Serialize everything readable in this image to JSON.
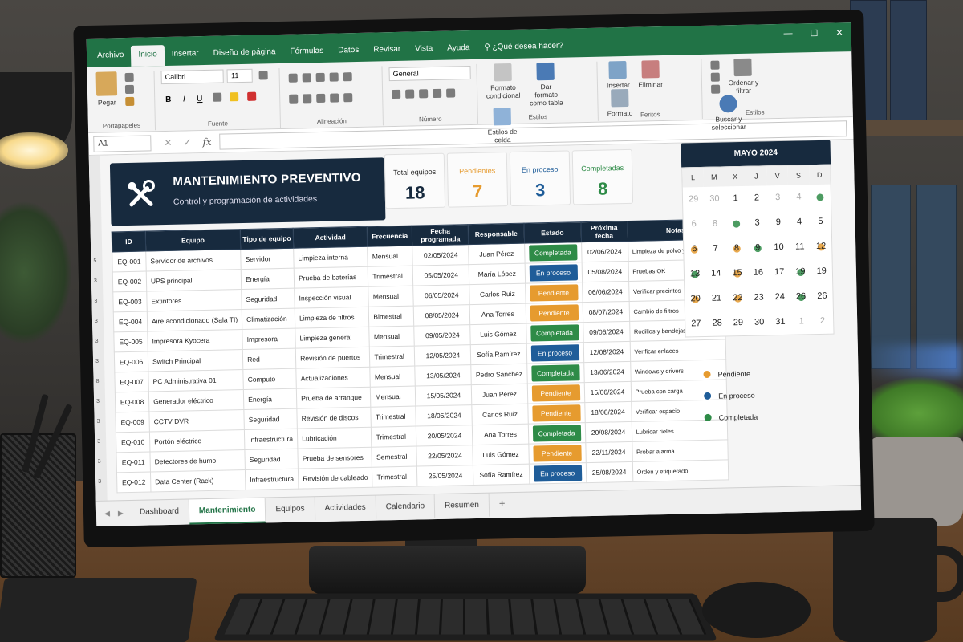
{
  "ribbon": {
    "tabs": [
      "Archivo",
      "Inicio",
      "Insertar",
      "Diseño de página",
      "Fórmulas",
      "Datos",
      "Revisar",
      "Vista",
      "Ayuda"
    ],
    "active_tab": "Inicio",
    "tell_me": "¿Qué desea hacer?",
    "paste_label": "Pegar",
    "clipboard_group": "Portapapeles",
    "font_name": "Calibri",
    "font_size": "11",
    "font_group": "Fuente",
    "alignment_group": "Alineación",
    "number_format": "General",
    "number_group": "Número",
    "cond_format_label": "Formato condicional",
    "format_table_label": "Dar formato como tabla",
    "cell_styles_label": "Estilos de celda",
    "styles_group": "Estilos",
    "insert_label": "Insertar",
    "delete_label": "Eliminar",
    "format_label": "Formato",
    "cells_group": "Feritos",
    "sort_label": "Ordenar y filtrar",
    "find_label": "Buscar y seleccionar",
    "editing_group": "Estilos"
  },
  "formula_bar": {
    "name_box": "A1",
    "fx": "fx"
  },
  "dashboard": {
    "title": "MANTENIMIENTO PREVENTIVO",
    "subtitle": "Control y programación de actividades",
    "kpis": [
      {
        "label": "Total equipos",
        "value": "18",
        "color": "#172a3e"
      },
      {
        "label": "Pendientes",
        "value": "7",
        "color": "#e69b2f"
      },
      {
        "label": "En proceso",
        "value": "3",
        "color": "#1f5d99"
      },
      {
        "label": "Completadas",
        "value": "8",
        "color": "#2e8b47"
      }
    ]
  },
  "table": {
    "headers": [
      "ID",
      "Equipo",
      "Tipo de equipo",
      "Actividad",
      "Frecuencia",
      "Fecha programada",
      "Responsable",
      "Estado",
      "Próxima fecha",
      "Notas"
    ],
    "rows": [
      [
        "EQ-001",
        "Servidor de archivos",
        "Servidor",
        "Limpieza interna",
        "Mensual",
        "02/05/2024",
        "Juan Pérez",
        "Completada",
        "02/06/2024",
        "Limpieza de polvo y ventiladores"
      ],
      [
        "EQ-002",
        "UPS principal",
        "Energía",
        "Prueba de baterías",
        "Trimestral",
        "05/05/2024",
        "María López",
        "En proceso",
        "05/08/2024",
        "Pruebas OK"
      ],
      [
        "EQ-003",
        "Extintores",
        "Seguridad",
        "Inspección visual",
        "Mensual",
        "06/05/2024",
        "Carlos Ruiz",
        "Pendiente",
        "06/06/2024",
        "Verificar precintos"
      ],
      [
        "EQ-004",
        "Aire acondicionado (Sala TI)",
        "Climatización",
        "Limpieza de filtros",
        "Bimestral",
        "08/05/2024",
        "Ana Torres",
        "Pendiente",
        "08/07/2024",
        "Cambio de filtros"
      ],
      [
        "EQ-005",
        "Impresora Kyocera",
        "Impresora",
        "Limpieza general",
        "Mensual",
        "09/05/2024",
        "Luis Gómez",
        "Completada",
        "09/06/2024",
        "Rodillos y bandejas"
      ],
      [
        "EQ-006",
        "Switch Principal",
        "Red",
        "Revisión de puertos",
        "Trimestral",
        "12/05/2024",
        "Sofía Ramírez",
        "En proceso",
        "12/08/2024",
        "Verificar enlaces"
      ],
      [
        "EQ-007",
        "PC Administrativa 01",
        "Computo",
        "Actualizaciones",
        "Mensual",
        "13/05/2024",
        "Pedro Sánchez",
        "Completada",
        "13/06/2024",
        "Windows y drivers"
      ],
      [
        "EQ-008",
        "Generador eléctrico",
        "Energía",
        "Prueba de arranque",
        "Mensual",
        "15/05/2024",
        "Juan Pérez",
        "Pendiente",
        "15/06/2024",
        "Prueba con carga"
      ],
      [
        "EQ-009",
        "CCTV DVR",
        "Seguridad",
        "Revisión de discos",
        "Trimestral",
        "18/05/2024",
        "Carlos Ruiz",
        "Pendiente",
        "18/08/2024",
        "Verificar espacio"
      ],
      [
        "EQ-010",
        "Portón eléctrico",
        "Infraestructura",
        "Lubricación",
        "Trimestral",
        "20/05/2024",
        "Ana Torres",
        "Completada",
        "20/08/2024",
        "Lubricar rieles"
      ],
      [
        "EQ-011",
        "Detectores de humo",
        "Seguridad",
        "Prueba de sensores",
        "Semestral",
        "22/05/2024",
        "Luis Gómez",
        "Pendiente",
        "22/11/2024",
        "Probar alarma"
      ],
      [
        "EQ-012",
        "Data Center (Rack)",
        "Infraestructura",
        "Revisión de cableado",
        "Trimestral",
        "25/05/2024",
        "Sofía Ramírez",
        "En proceso",
        "25/08/2024",
        "Orden y etiquetado"
      ]
    ],
    "row_numbers": [
      "5",
      "3",
      "3",
      "3",
      "3",
      "3",
      "8",
      "3",
      "3",
      "3",
      "3",
      "3"
    ],
    "status_colors": {
      "Completada": "#2e8b47",
      "En proceso": "#1f5d99",
      "Pendiente": "#e69b2f"
    }
  },
  "calendar": {
    "title": "MAYO 2024",
    "weekdays": [
      "L",
      "M",
      "X",
      "J",
      "V",
      "S",
      "D"
    ],
    "days": [
      {
        "d": "29",
        "muted": true
      },
      {
        "d": "30",
        "muted": true
      },
      {
        "d": "1"
      },
      {
        "d": "2"
      },
      {
        "d": "3",
        "muted": true
      },
      {
        "d": "4",
        "muted": true
      },
      {
        "d": "",
        "dot": "#2e8b47"
      },
      {
        "d": "6",
        "muted": true
      },
      {
        "d": "8",
        "muted": true
      },
      {
        "d": "",
        "dot": "#2e8b47"
      },
      {
        "d": "3"
      },
      {
        "d": "9"
      },
      {
        "d": "4"
      },
      {
        "d": "5"
      },
      {
        "d": "6",
        "dot": "#e69b2f"
      },
      {
        "d": "7"
      },
      {
        "d": "8",
        "dot": "#e69b2f"
      },
      {
        "d": "9",
        "dot": "#2e8b47"
      },
      {
        "d": "10"
      },
      {
        "d": "11"
      },
      {
        "d": "12",
        "dot": "#e69b2f"
      },
      {
        "d": "13",
        "dot": "#2e8b47"
      },
      {
        "d": "14"
      },
      {
        "d": "15",
        "dot": "#e69b2f"
      },
      {
        "d": "16"
      },
      {
        "d": "17"
      },
      {
        "d": "19",
        "dot": "#2e8b47"
      },
      {
        "d": "19"
      },
      {
        "d": "20",
        "dot": "#e69b2f"
      },
      {
        "d": "21"
      },
      {
        "d": "22",
        "dot": "#e69b2f"
      },
      {
        "d": "23"
      },
      {
        "d": "24"
      },
      {
        "d": "26",
        "dot": "#2e8b47"
      },
      {
        "d": "26"
      },
      {
        "d": "27"
      },
      {
        "d": "28"
      },
      {
        "d": "29"
      },
      {
        "d": "30"
      },
      {
        "d": "31"
      },
      {
        "d": "1",
        "muted": true
      },
      {
        "d": "2",
        "muted": true
      }
    ],
    "legend": [
      {
        "label": "Pendiente",
        "color": "#e69b2f"
      },
      {
        "label": "En proceso",
        "color": "#1f5d99"
      },
      {
        "label": "Completada",
        "color": "#2e8b47"
      }
    ]
  },
  "sheet_tabs": [
    "Dashboard",
    "Mantenimiento",
    "Equipos",
    "Actividades",
    "Calendario",
    "Resumen"
  ],
  "active_sheet": "Mantenimiento",
  "add_sheet": "+"
}
